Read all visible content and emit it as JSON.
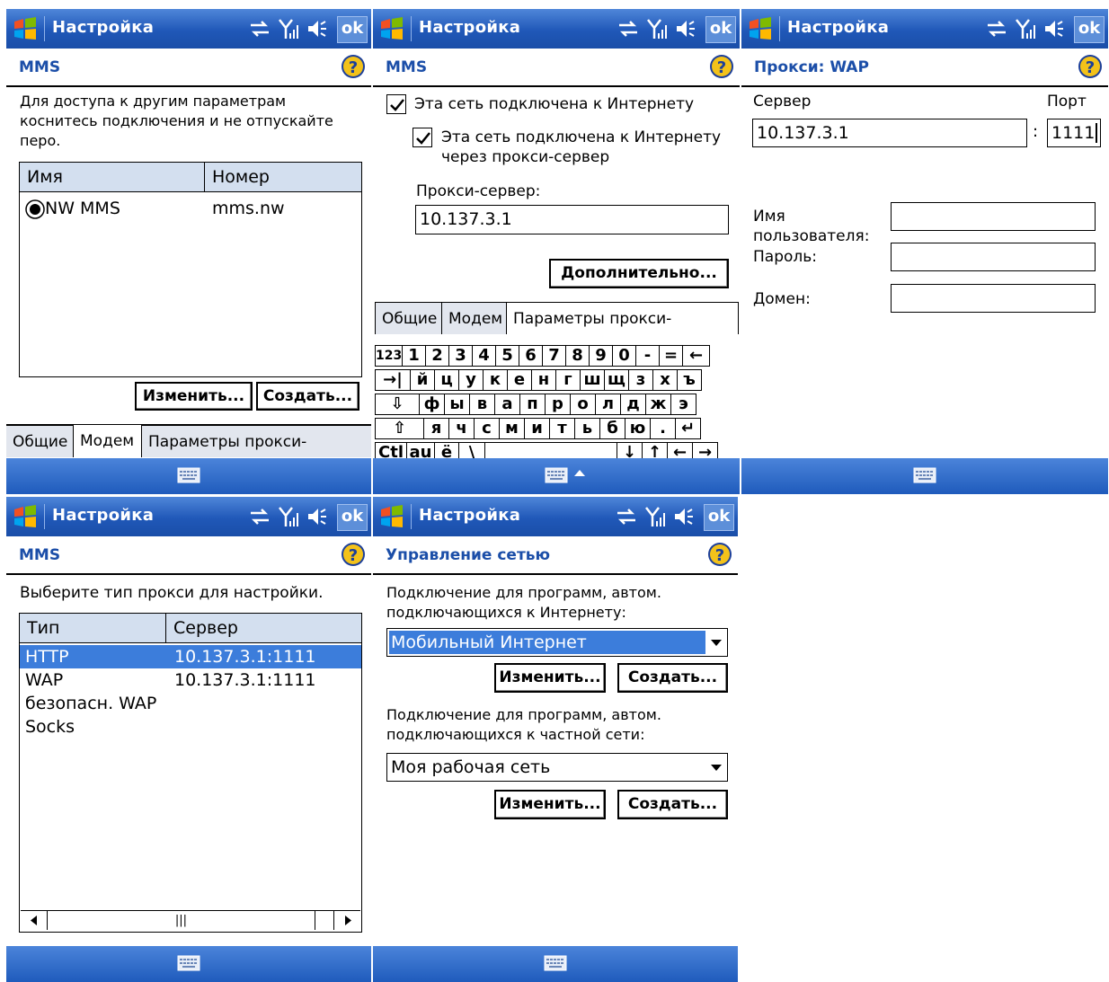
{
  "common": {
    "app_title": "Настройка",
    "ok_label": "ok"
  },
  "screen1": {
    "header": "MMS",
    "instruction": "Для доступа к другим параметрам коснитесь подключения и не отпускайте перо.",
    "columns": [
      "Имя",
      "Номер"
    ],
    "rows": [
      {
        "name": "NW MMS",
        "number": "mms.nw"
      }
    ],
    "edit_button": "Изменить...",
    "create_button": "Создать...",
    "tabs": [
      "Общие",
      "Модем",
      "Параметры прокси-сервера"
    ]
  },
  "screen2": {
    "header": "MMS",
    "check1": "Эта сеть подключена к Интернету",
    "check2_line1": "Эта сеть подключена к Интернету",
    "check2_line2": "через прокси-сервер",
    "proxy_label": "Прокси-сервер:",
    "proxy_value": "10.137.3.1",
    "advanced_button": "Дополнительно...",
    "tabs": [
      "Общие",
      "Модем",
      "Параметры прокси-сервера"
    ],
    "keyboard": {
      "row1": [
        "123",
        "1",
        "2",
        "3",
        "4",
        "5",
        "6",
        "7",
        "8",
        "9",
        "0",
        "-",
        "=",
        "←"
      ],
      "row2": [
        "→|",
        "й",
        "ц",
        "у",
        "к",
        "е",
        "н",
        "г",
        "ш",
        "щ",
        "з",
        "х",
        "ъ"
      ],
      "row3": [
        "⇩",
        "ф",
        "ы",
        "в",
        "а",
        "п",
        "р",
        "о",
        "л",
        "д",
        "ж",
        "э"
      ],
      "row4": [
        "⇧",
        "я",
        "ч",
        "с",
        "м",
        "и",
        "т",
        "ь",
        "б",
        "ю",
        ".",
        "↵"
      ],
      "row5": [
        "Ctl",
        "au",
        "ё",
        "\\",
        "",
        "↓",
        "↑",
        "←",
        "→"
      ]
    }
  },
  "screen3": {
    "header": "Прокси: WAP",
    "server_label": "Сервер",
    "port_label": "Порт",
    "server_value": "10.137.3.1",
    "colon": ":",
    "port_value": "1111",
    "username_label_line1": "Имя",
    "username_label_line2": "пользователя:",
    "password_label": "Пароль:",
    "domain_label": "Домен:"
  },
  "screen4": {
    "header": "MMS",
    "instruction": "Выберите тип прокси для настройки.",
    "columns": [
      "Тип",
      "Сервер"
    ],
    "rows": [
      {
        "type": "HTTP",
        "server": "10.137.3.1:1111",
        "selected": true
      },
      {
        "type": "WAP",
        "server": "10.137.3.1:1111"
      },
      {
        "type": "безопасн. WAP",
        "server": ""
      },
      {
        "type": "Socks",
        "server": ""
      }
    ]
  },
  "screen5": {
    "header": "Управление сетью",
    "internet_label_line1": "Подключение для программ, автом.",
    "internet_label_line2": "подключающихся к Интернету:",
    "internet_value": "Мобильный Интернет",
    "private_label_line1": "Подключение для программ, автом.",
    "private_label_line2": "подключающихся к частной сети:",
    "private_value": "Моя рабочая сеть",
    "edit_button": "Изменить...",
    "create_button": "Создать..."
  },
  "colors": {
    "titlebar": "#2058b8",
    "header_text": "#1b4ea8",
    "selection": "#3c7ddb",
    "listview_header": "#d3dfef"
  }
}
